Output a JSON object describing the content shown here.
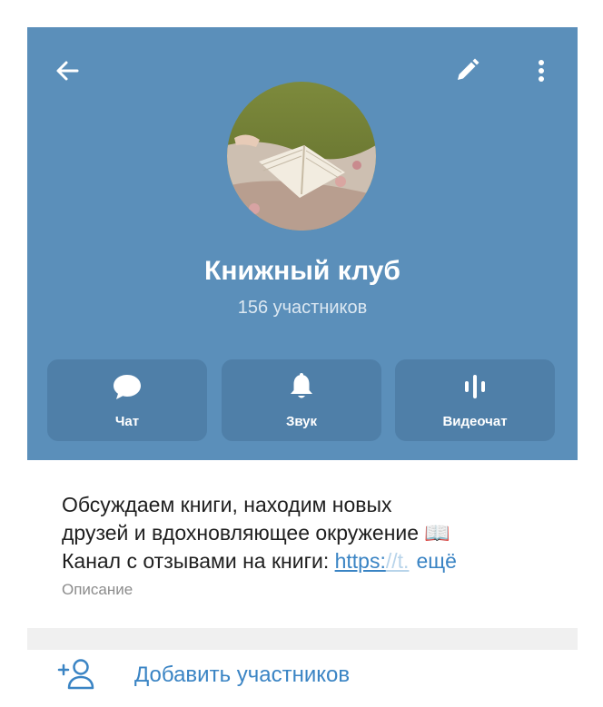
{
  "header": {
    "title": "Книжный клуб",
    "subtitle": "156 участников",
    "icons": {
      "back": "arrow-left-icon",
      "edit": "pencil-icon",
      "more": "more-vertical-icon"
    },
    "colors": {
      "header_bg": "#5b8fba",
      "button_bg": "#4f7fa8",
      "accent": "#3a84c4"
    }
  },
  "actions": [
    {
      "label": "Чат",
      "icon": "chat-bubble-icon"
    },
    {
      "label": "Звук",
      "icon": "bell-icon"
    },
    {
      "label": "Видеочат",
      "icon": "voice-wave-icon"
    }
  ],
  "description": {
    "line1": "Обсуждаем книги, находим новых",
    "line2": "друзей и вдохновляющее окружение 📖",
    "line3_prefix": "Канал с отзывами на книги: ",
    "link_visible": "https:",
    "link_faded": "//t.",
    "more_label": "ещё",
    "caption": "Описание"
  },
  "add_members": {
    "label": "Добавить участников",
    "icon": "add-user-icon"
  }
}
